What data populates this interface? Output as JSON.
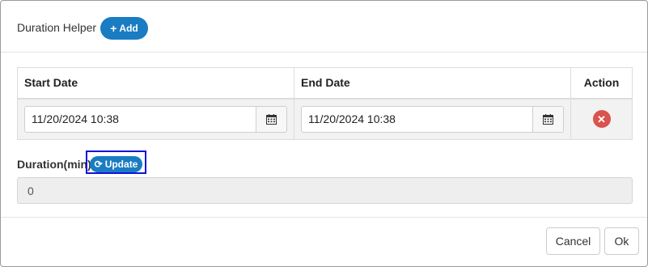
{
  "header": {
    "title": "Duration Helper",
    "add_label": "Add"
  },
  "table": {
    "columns": [
      "Start Date",
      "End Date",
      "Action"
    ],
    "rows": [
      {
        "start": "11/20/2024 10:38",
        "end": "11/20/2024 10:38"
      }
    ]
  },
  "duration": {
    "label": "Duration(min)",
    "update_label": "Update",
    "value": "0"
  },
  "footer": {
    "cancel_label": "Cancel",
    "ok_label": "Ok"
  },
  "icons": {
    "add": "plus-icon",
    "calendar": "calendar-icon",
    "remove": "times-circle-icon",
    "update": "refresh-icon"
  },
  "colors": {
    "primary": "#1a7cc2",
    "danger": "#d9534f",
    "highlight": "#1212d8"
  }
}
